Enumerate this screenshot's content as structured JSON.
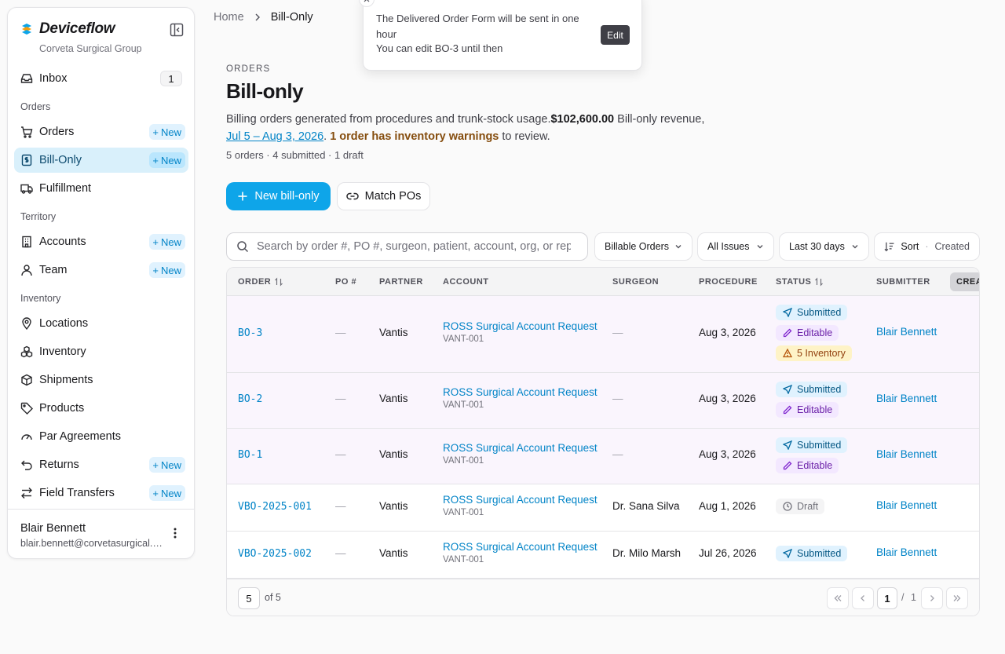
{
  "brand": {
    "name": "Deviceflow",
    "org": "Corveta Surgical Group"
  },
  "sidebar": {
    "inbox": {
      "label": "Inbox",
      "count": "1"
    },
    "sections": {
      "orders": "Orders",
      "territory": "Territory",
      "inventory": "Inventory"
    },
    "new_label": "New",
    "items": {
      "orders": "Orders",
      "bill_only": "Bill-Only",
      "fulfillment": "Fulfillment",
      "accounts": "Accounts",
      "team": "Team",
      "locations": "Locations",
      "inventory": "Inventory",
      "shipments": "Shipments",
      "products": "Products",
      "par_agreements": "Par Agreements",
      "returns": "Returns",
      "field_transfers": "Field Transfers"
    },
    "user": {
      "name": "Blair Bennett",
      "email": "blair.bennett@corvetasurgical.com"
    }
  },
  "breadcrumb": {
    "home": "Home",
    "current": "Bill-Only"
  },
  "toast": {
    "line1": "The Delivered Order Form will be sent in one hour",
    "line2": "You can edit BO-3 until then",
    "action": "Edit"
  },
  "header": {
    "eyebrow": "ORDERS",
    "title": "Bill-only",
    "desc_start": "Billing orders generated from procedures and trunk-stock usage.",
    "revenue": "$102,600.00",
    "revenue_label": " Bill-only revenue, ",
    "date_range": "Jul 5 – Aug 3, 2026",
    "warning": "1 order has inventory warnings",
    "warning_suffix": " to review.",
    "counts": "5 orders · 4 submitted · 1 draft"
  },
  "actions": {
    "new_bill_only": "New bill-only",
    "match_pos": "Match POs"
  },
  "filters": {
    "search_placeholder": "Search by order #, PO #, surgeon, patient, account, org, or rep...",
    "billable": "Billable Orders",
    "issues": "All Issues",
    "range": "Last 30 days",
    "sort_label": "Sort",
    "sort_sep": "·",
    "sort_value": "Created"
  },
  "table": {
    "columns": {
      "order": "ORDER",
      "po": "PO #",
      "partner": "PARTNER",
      "account": "ACCOUNT",
      "surgeon": "SURGEON",
      "procedure": "PROCEDURE",
      "status": "STATUS",
      "submitter": "SUBMITTER",
      "created": "CREATED"
    },
    "rows": [
      {
        "order": "BO-3",
        "po": "—",
        "partner": "Vantis",
        "account": "ROSS Surgical Account Request",
        "account_code": "VANT-001",
        "surgeon": "—",
        "procedure": "Aug 3, 2026",
        "submitter": "Blair Bennett",
        "chips": {
          "submitted": "Submitted",
          "editable": "Editable",
          "inventory": "5 Inventory"
        }
      },
      {
        "order": "BO-2",
        "po": "—",
        "partner": "Vantis",
        "account": "ROSS Surgical Account Request",
        "account_code": "VANT-001",
        "surgeon": "—",
        "procedure": "Aug 3, 2026",
        "submitter": "Blair Bennett",
        "chips": {
          "submitted": "Submitted",
          "editable": "Editable"
        }
      },
      {
        "order": "BO-1",
        "po": "—",
        "partner": "Vantis",
        "account": "ROSS Surgical Account Request",
        "account_code": "VANT-001",
        "surgeon": "—",
        "procedure": "Aug 3, 2026",
        "submitter": "Blair Bennett",
        "chips": {
          "submitted": "Submitted",
          "editable": "Editable"
        }
      },
      {
        "order": "VBO-2025-001",
        "po": "—",
        "partner": "Vantis",
        "account": "ROSS Surgical Account Request",
        "account_code": "VANT-001",
        "surgeon": "Dr. Sana Silva",
        "procedure": "Aug 1, 2026",
        "submitter": "Blair Bennett",
        "chips": {
          "draft": "Draft"
        }
      },
      {
        "order": "VBO-2025-002",
        "po": "—",
        "partner": "Vantis",
        "account": "ROSS Surgical Account Request",
        "account_code": "VANT-001",
        "surgeon": "Dr. Milo Marsh",
        "procedure": "Jul 26, 2026",
        "submitter": "Blair Bennett",
        "chips": {
          "submitted": "Submitted"
        }
      }
    ]
  },
  "pagination": {
    "page_size": "5",
    "of_label": "of 5",
    "current": "1",
    "sep": "/",
    "total": "1"
  },
  "colors": {
    "accent": "#0ea5e9",
    "link": "#0284c7",
    "active_nav": "#d9f0fb",
    "warning": "#854d0e"
  },
  "icons": [
    "inbox-icon",
    "cart-icon",
    "invoice-icon",
    "truck-icon",
    "building-icon",
    "user-icon",
    "map-pin-icon",
    "boxes-icon",
    "package-icon",
    "tag-icon",
    "gauge-icon",
    "undo-icon",
    "transfer-icon",
    "send-icon",
    "pencil-icon",
    "warning-icon",
    "clock-icon",
    "search-icon",
    "link-icon",
    "plus-icon",
    "chevron-down-icon",
    "sort-icon"
  ]
}
